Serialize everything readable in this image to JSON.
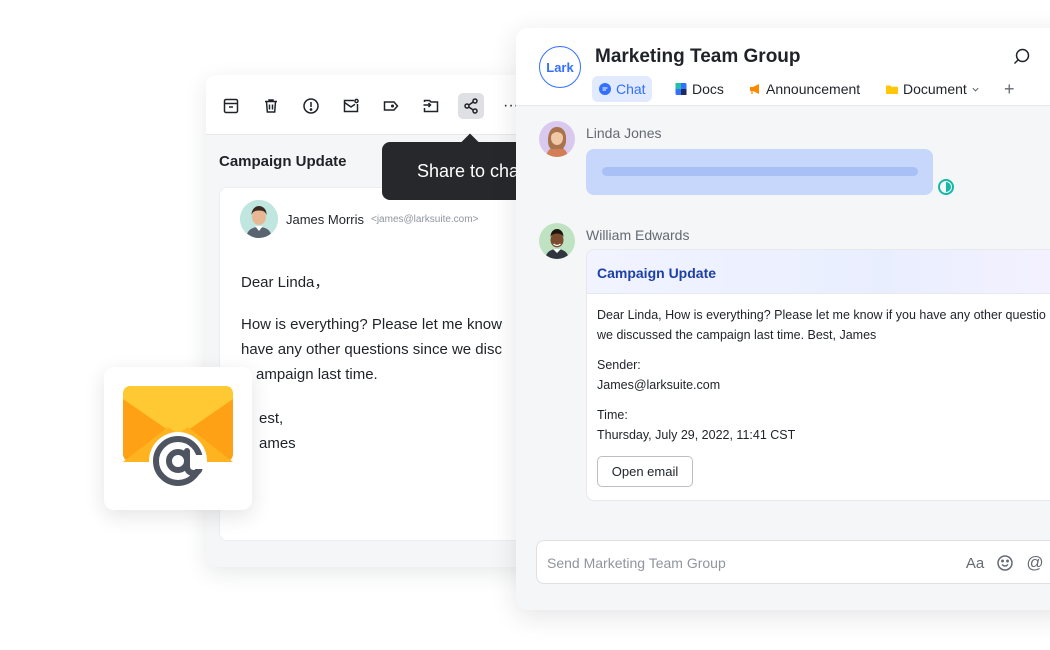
{
  "email": {
    "subject": "Campaign Update",
    "sender_name": "James Morris",
    "sender_address": "<james@larksuite.com>",
    "body_lines": [
      "Dear Linda，",
      "How is everything? Please let me know",
      "have any other questions since we disc",
      "ampaign last time.",
      "est,",
      "ames"
    ],
    "toolbar": {
      "more_label": "···"
    }
  },
  "tooltip": {
    "text": "Share to chat"
  },
  "chat": {
    "logo_text": "Lark",
    "group_title": "Marketing Team Group",
    "tabs": [
      {
        "label": "Chat",
        "active": true
      },
      {
        "label": "Docs",
        "active": false
      },
      {
        "label": "Announcement",
        "active": false
      },
      {
        "label": "Document",
        "active": false
      }
    ],
    "add_tab_label": "+",
    "messages": [
      {
        "sender": "Linda Jones"
      },
      {
        "sender": "William Edwards"
      }
    ],
    "email_card": {
      "title": "Campaign Update",
      "body_line1": "Dear Linda, How is everything? Please let me know if you have any other questio",
      "body_line2": "we discussed the campaign last time.  Best, James",
      "sender_label": "Sender:",
      "sender_value": "James@larksuite.com",
      "time_label": "Time:",
      "time_value": "Thursday, July 29, 2022, 11:41 CST",
      "button_label": "Open email"
    },
    "input": {
      "placeholder": "Send Marketing Team Group",
      "font_icon_label": "Aa",
      "mention_icon_label": "@"
    }
  },
  "colors": {
    "accent": "#3370ff",
    "tooltip_bg": "#26282b",
    "envelope_yellow": "#ffc933",
    "envelope_orange": "#ffa114",
    "at_sign": "#4e5560"
  }
}
